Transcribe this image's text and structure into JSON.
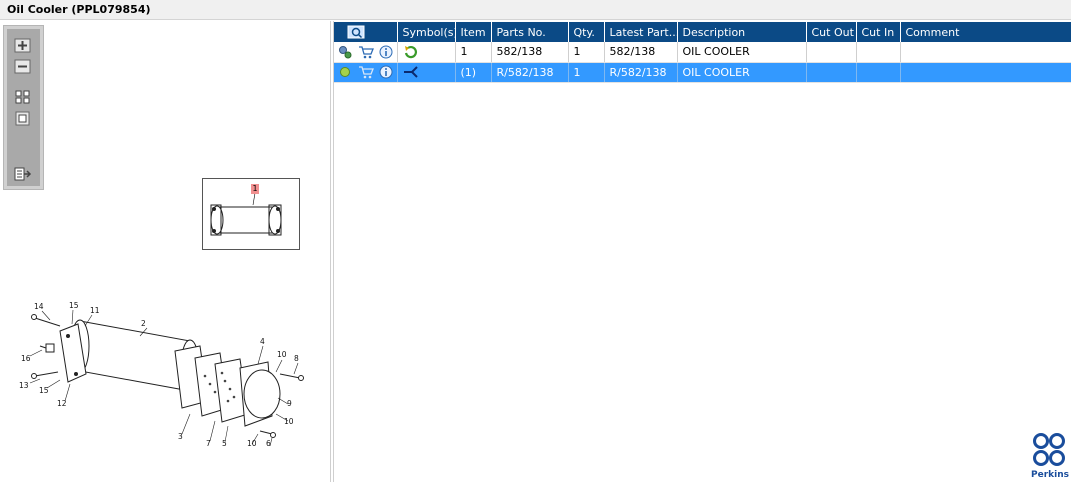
{
  "window": {
    "title": "Oil Cooler (PPL079854)"
  },
  "toolbar": {
    "buttons": [
      "zoom-in",
      "zoom-out",
      "fit-all",
      "fit-window",
      "export"
    ]
  },
  "thumbnail": {
    "callout": "1"
  },
  "diagram": {
    "callouts": [
      "14",
      "15",
      "11",
      "2",
      "4",
      "10",
      "8",
      "16",
      "13",
      "15",
      "12",
      "3",
      "7",
      "5",
      "10",
      "6",
      "9",
      "10"
    ]
  },
  "table": {
    "headers": [
      "Symbol(s)",
      "Item",
      "Parts No.",
      "Qty.",
      "Latest Part...",
      "Description",
      "Cut Out",
      "Cut In",
      "Comment"
    ],
    "rows": [
      {
        "item": "1",
        "parts_no": "582/138",
        "qty": "1",
        "latest_part": "582/138",
        "description": "OIL COOLER",
        "cut_out": "",
        "cut_in": "",
        "comment": ""
      },
      {
        "item": "(1)",
        "parts_no": "R/582/138",
        "qty": "1",
        "latest_part": "R/582/138",
        "description": "OIL COOLER",
        "cut_out": "",
        "cut_in": "",
        "comment": ""
      }
    ]
  },
  "logo": {
    "text": "Perkins"
  },
  "colors": {
    "header": "#0b4a86",
    "selection": "#3399ff",
    "logo": "#1a4d9c"
  }
}
